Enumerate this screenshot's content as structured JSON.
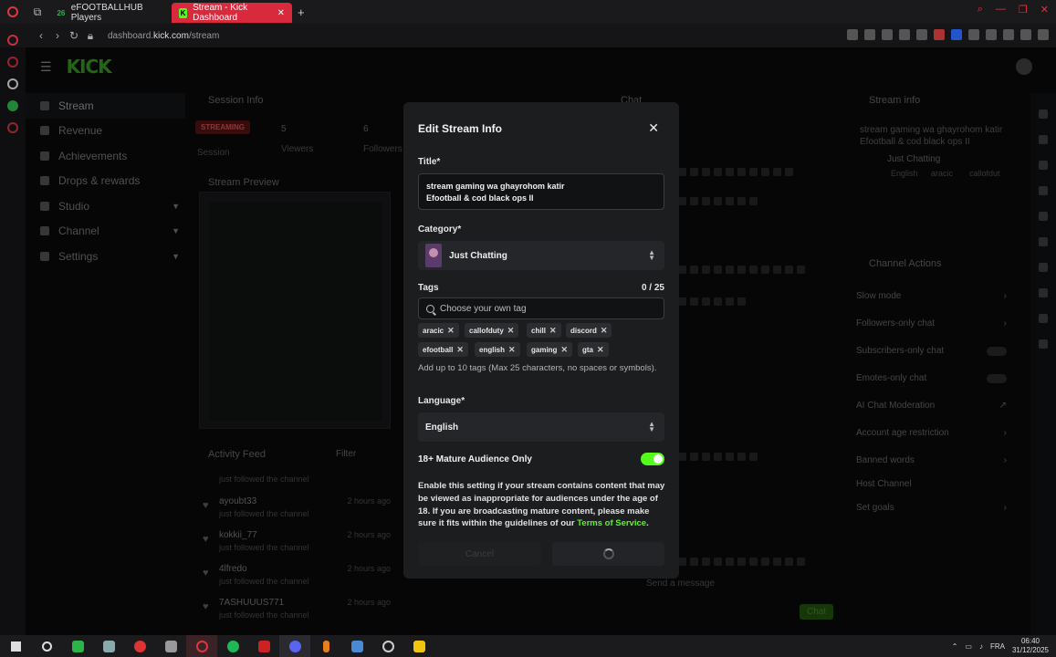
{
  "browser": {
    "tabs": [
      {
        "label": "eFOOTBALLHUB Players",
        "favicon": "26"
      },
      {
        "label": "Stream - Kick Dashboard",
        "favicon": "K"
      }
    ],
    "url_domain": "dashboard.",
    "url_host": "kick.com",
    "url_path": "/stream"
  },
  "brand": {
    "logo": "KICK",
    "accent": "#53fc18"
  },
  "sidebar": {
    "items": [
      {
        "label": "Stream"
      },
      {
        "label": "Revenue"
      },
      {
        "label": "Achievements"
      },
      {
        "label": "Drops & rewards"
      },
      {
        "label": "Studio"
      },
      {
        "label": "Channel"
      },
      {
        "label": "Settings"
      }
    ]
  },
  "session": {
    "title": "Session Info",
    "badge": "STREAMING",
    "session_label": "Session",
    "viewers_value": "5",
    "viewers_label": "Viewers",
    "followers_value": "6",
    "followers_label": "Followers"
  },
  "preview": {
    "title": "Stream Preview"
  },
  "chat": {
    "title": "Chat",
    "placeholder": "Send a message",
    "send_label": "Chat"
  },
  "activity": {
    "title": "Activity Feed",
    "filter": "Filter",
    "items": [
      {
        "name": "",
        "sub": "just followed the channel",
        "time": ""
      },
      {
        "name": "ayoubt33",
        "sub": "just followed the channel",
        "time": "2 hours ago"
      },
      {
        "name": "kokkii_77",
        "sub": "just followed the channel",
        "time": "2 hours ago"
      },
      {
        "name": "4lfredo",
        "sub": "just followed the channel",
        "time": "2 hours ago"
      },
      {
        "name": "7ASHUUUS771",
        "sub": "just followed the channel",
        "time": "2 hours ago"
      }
    ]
  },
  "stream_info": {
    "title": "Stream info",
    "stream_title": "stream gaming wa ghayrohom katir Efootball & cod black ops II",
    "category": "Just Chatting",
    "tags_preview": [
      "English",
      "aracic",
      "callofdut"
    ]
  },
  "channel_actions": {
    "title": "Channel Actions",
    "items": [
      {
        "label": "Slow mode",
        "kind": "arrow"
      },
      {
        "label": "Followers-only chat",
        "kind": "arrow"
      },
      {
        "label": "Subscribers-only chat",
        "kind": "toggle"
      },
      {
        "label": "Emotes-only chat",
        "kind": "toggle"
      },
      {
        "label": "AI Chat Moderation",
        "kind": "link"
      },
      {
        "label": "Account age restriction",
        "kind": "arrow"
      },
      {
        "label": "Banned words",
        "kind": "arrow"
      },
      {
        "label": "Host Channel",
        "kind": "none"
      },
      {
        "label": "Set goals",
        "kind": "arrow"
      }
    ]
  },
  "modal": {
    "title": "Edit Stream Info",
    "title_label": "Title*",
    "title_value": "stream gaming wa ghayrohom katir\nEfootball & cod black ops II",
    "category_label": "Category*",
    "category_value": "Just Chatting",
    "tags_label": "Tags",
    "tags_counter": "0 / 25",
    "tags_placeholder": "Choose your own tag",
    "tags": [
      "aracic",
      "callofduty",
      "chill",
      "discord",
      "efootball",
      "english",
      "gaming",
      "gta"
    ],
    "tags_help": "Add up to 10 tags (Max 25 characters, no spaces or symbols).",
    "language_label": "Language*",
    "language_value": "English",
    "mature_label": "18+ Mature Audience Only",
    "mature_enabled": true,
    "mature_text": "Enable this setting if your stream contains content that may be viewed as inappropriate for audiences under the age of 18. If you are broadcasting mature content, please make sure it fits within the guidelines of our ",
    "mature_link": "Terms of Service",
    "mature_end": ".",
    "cancel_label": "Cancel"
  },
  "taskbar": {
    "language": "FRA",
    "time": "06:40",
    "date": "31/12/2025"
  }
}
